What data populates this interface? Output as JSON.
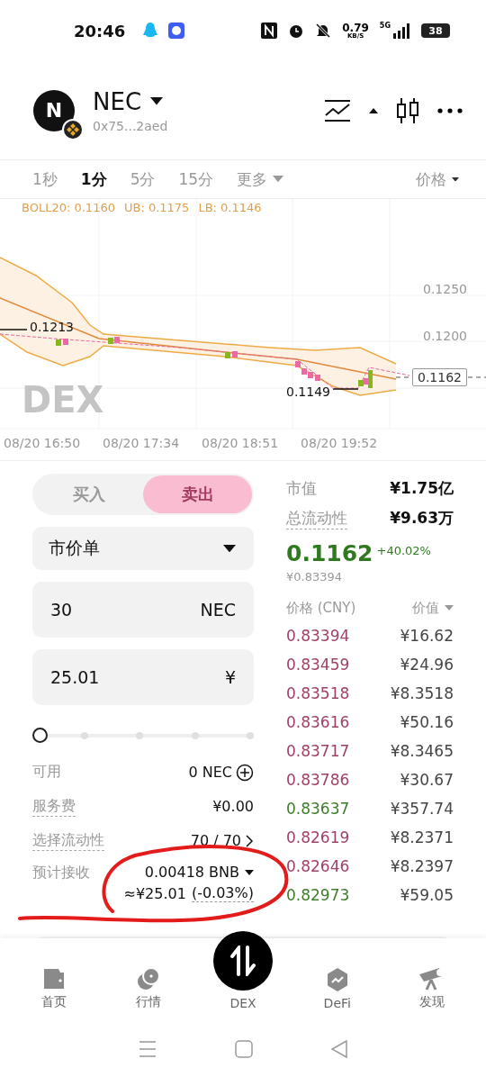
{
  "status_bar": {
    "time": "20:46",
    "speed": "0.79",
    "speed_unit": "KB/S",
    "network": "5G",
    "battery": "38"
  },
  "header": {
    "avatar_letter": "N",
    "token": "NEC",
    "address": "0x75...2aed"
  },
  "timeframes": [
    {
      "label": "1秒",
      "selected": false
    },
    {
      "label": "1分",
      "selected": true
    },
    {
      "label": "5分",
      "selected": false
    },
    {
      "label": "15分",
      "selected": false
    },
    {
      "label": "更多",
      "selected": false
    }
  ],
  "price_menu": "价格",
  "chart": {
    "legend": [
      {
        "text": "BOLL20: 0.1160"
      },
      {
        "text": "UB: 0.1175"
      },
      {
        "text": "LB: 0.1146"
      }
    ],
    "y_labels": [
      "0.1250",
      "0.1200"
    ],
    "high_label": "0.1213",
    "low_label": "0.1149",
    "current_price": "0.1162",
    "watermark": "DEX",
    "x_labels": [
      "08/20 16:50",
      "08/20 17:34",
      "08/20 18:51",
      "08/20 19:52"
    ]
  },
  "trade": {
    "sides": [
      {
        "label": "买入",
        "selected": false
      },
      {
        "label": "卖出",
        "selected": true
      }
    ],
    "order_type": "市价单",
    "quantity": {
      "value": "30",
      "unit": "NEC"
    },
    "amount": {
      "value": "25.01",
      "unit": "¥"
    },
    "slider": {
      "level": 0
    },
    "info": [
      {
        "label": "可用",
        "value": "0 NEC",
        "underlined": false
      },
      {
        "label": "服务费",
        "value": "¥0.00",
        "underlined": true
      },
      {
        "label": "选择流动性",
        "value": "70 / 70",
        "underlined": true
      }
    ],
    "receive": {
      "label": "预计接收",
      "amount": "0.00418 BNB",
      "approx": "≈¥25.01",
      "change": "(-0.03%)"
    }
  },
  "market": {
    "stats": [
      {
        "label": "市值",
        "value": "¥1.75亿",
        "underlined": false
      },
      {
        "label": "总流动性",
        "value": "¥9.63万",
        "underlined": true
      }
    ],
    "price": "0.1162",
    "change": "+40.02%",
    "cny_price": "¥0.83394",
    "columns": [
      "价格 (CNY)",
      "价值"
    ],
    "trades": [
      {
        "price": "0.83394",
        "value": "¥16.62",
        "color": "#a0416a"
      },
      {
        "price": "0.83459",
        "value": "¥24.96",
        "color": "#a0416a"
      },
      {
        "price": "0.83518",
        "value": "¥8.3518",
        "color": "#a0416a"
      },
      {
        "price": "0.83616",
        "value": "¥50.16",
        "color": "#a0416a"
      },
      {
        "price": "0.83717",
        "value": "¥8.3465",
        "color": "#a0416a"
      },
      {
        "price": "0.83786",
        "value": "¥30.67",
        "color": "#a0416a"
      },
      {
        "price": "0.83637",
        "value": "¥357.74",
        "color": "#3f7d2c"
      },
      {
        "price": "0.82619",
        "value": "¥8.2371",
        "color": "#a0416a"
      },
      {
        "price": "0.82646",
        "value": "¥8.2397",
        "color": "#a0416a"
      },
      {
        "price": "0.82973",
        "value": "¥59.05",
        "color": "#3f7d2c"
      }
    ]
  },
  "bottom_nav": [
    {
      "label": "首页",
      "kind": "wallet"
    },
    {
      "label": "行情",
      "kind": "coins"
    },
    {
      "label": "DEX",
      "kind": "swap"
    },
    {
      "label": "DeFi",
      "kind": "hexagon"
    },
    {
      "label": "发现",
      "kind": "telescope"
    }
  ]
}
